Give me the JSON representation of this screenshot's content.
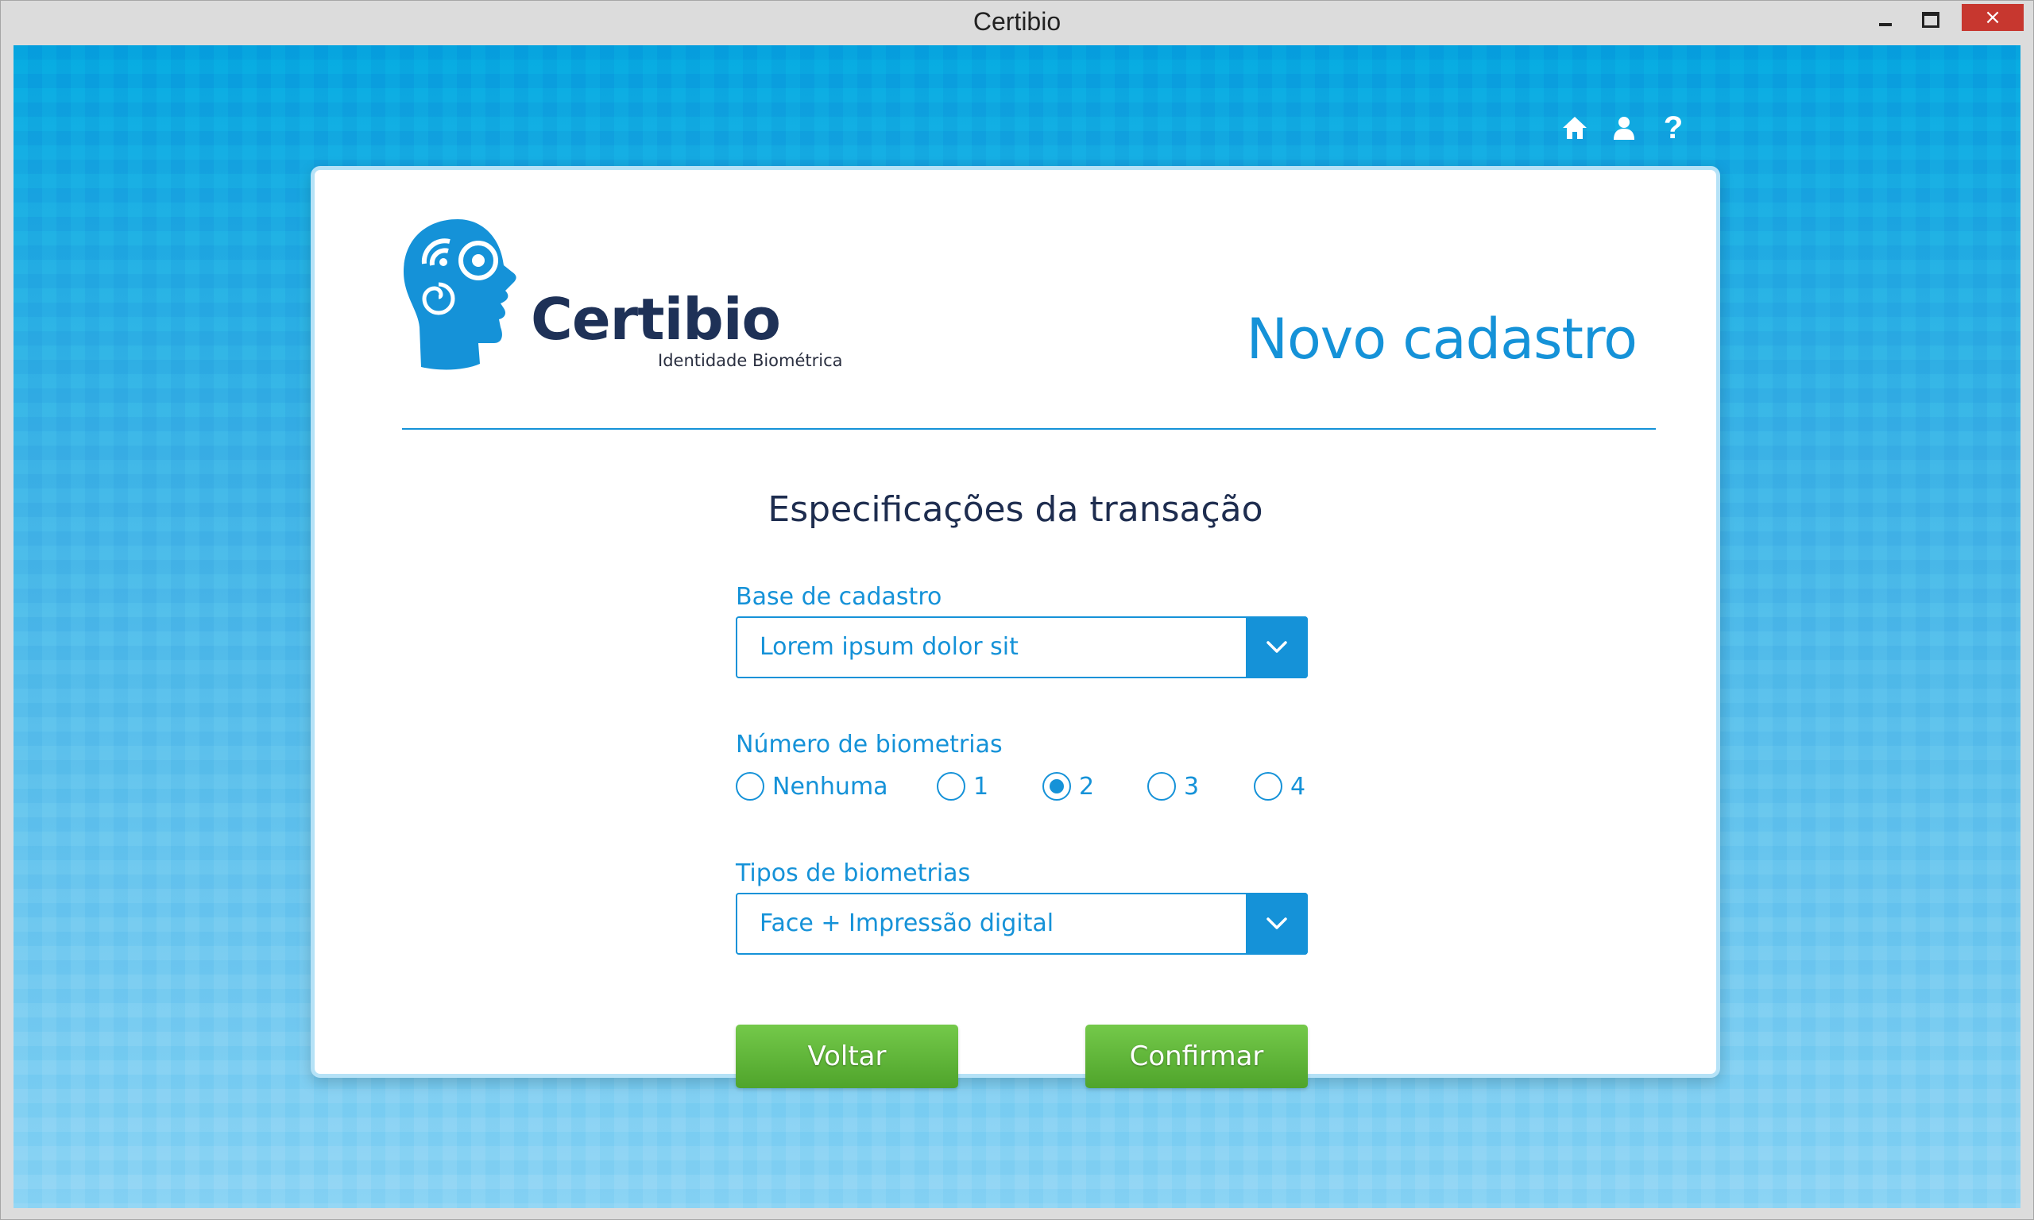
{
  "window": {
    "title": "Certibio",
    "minimize_icon": "minimize-icon",
    "maximize_icon": "maximize-icon",
    "close_label": "×"
  },
  "topbar": {
    "icons": [
      "home-icon",
      "user-icon",
      "help-icon"
    ],
    "help_label": "?"
  },
  "logo": {
    "name": "Certibio",
    "subtitle": "Identidade Biométrica",
    "brand_color": "#1592d8",
    "text_color": "#1e3157"
  },
  "page": {
    "heading": "Novo cadastro",
    "section_title": "Especificações da transação"
  },
  "form": {
    "base": {
      "label": "Base de cadastro",
      "value": "Lorem ipsum dolor sit"
    },
    "numero": {
      "label": "Número de biometrias",
      "options": [
        "Nenhuma",
        "1",
        "2",
        "3",
        "4"
      ],
      "selected": "2"
    },
    "tipos": {
      "label": "Tipos de biometrias",
      "value": "Face + Impressão digital"
    }
  },
  "buttons": {
    "back_label": "Voltar",
    "confirm_label": "Confirmar",
    "color": "#5aae33"
  },
  "colors": {
    "accent": "#1592d8",
    "background_top": "#05a3df",
    "background_bottom": "#8ad3f4"
  }
}
